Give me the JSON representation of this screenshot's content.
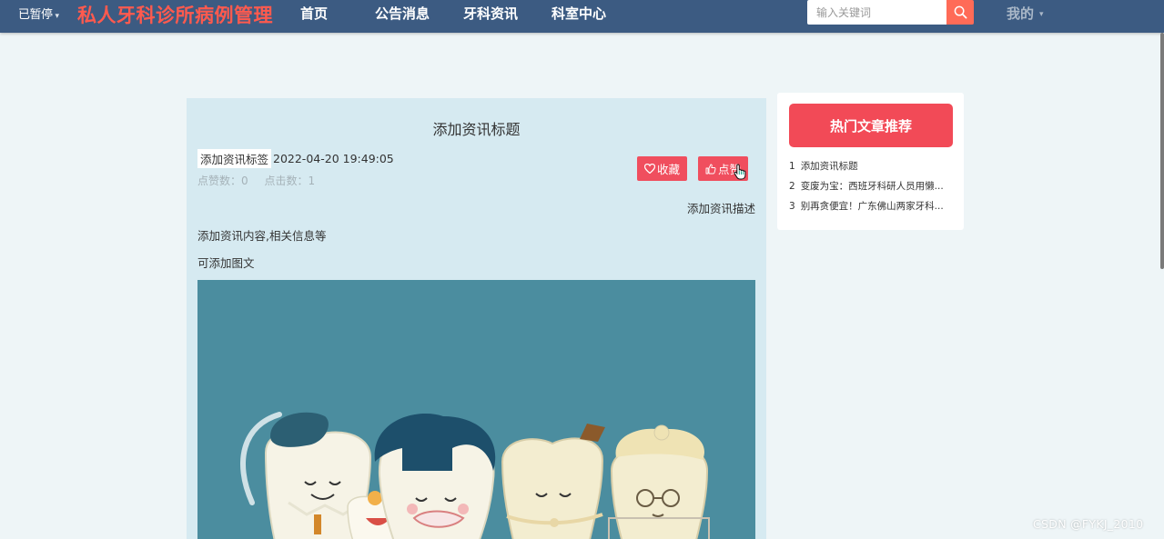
{
  "nav": {
    "paused_label": "已暂停",
    "brand": "私人牙科诊所病例管理",
    "items": [
      {
        "label": "首页"
      },
      {
        "label": "公告消息"
      },
      {
        "label": "牙科资讯"
      },
      {
        "label": "科室中心"
      }
    ],
    "search_placeholder": "输入关键词",
    "mine_label": "我的"
  },
  "article": {
    "title": "添加资讯标题",
    "tag": "添加资讯标签",
    "date": "2022-04-20 19:49:05",
    "likes_label": "点赞数：0",
    "clicks_label": "点击数：1",
    "favorite_label": "收藏",
    "like_label": "点赞",
    "description": "添加资讯描述",
    "content_line1": "添加资讯内容,相关信息等",
    "content_line2": "可添加图文"
  },
  "sidebar": {
    "title": "热门文章推荐",
    "items": [
      {
        "num": "1",
        "text": "添加资讯标题"
      },
      {
        "num": "2",
        "text": "变废为宝：西班牙科研人员用懒..."
      },
      {
        "num": "3",
        "text": "别再贪便宜！广东佛山两家牙科..."
      }
    ]
  },
  "watermark": "CSDN @FYKJ_2010",
  "colors": {
    "navbar": "#3c5b82",
    "brand": "#ff5a4e",
    "accent": "#f04e5e",
    "panel": "#d6eaf1",
    "illustration_bg": "#4b8d9f"
  },
  "icons": {
    "search": "search-icon",
    "favorite": "heart-icon",
    "like": "thumbs-up-icon",
    "cursor": "hand-cursor-icon"
  }
}
